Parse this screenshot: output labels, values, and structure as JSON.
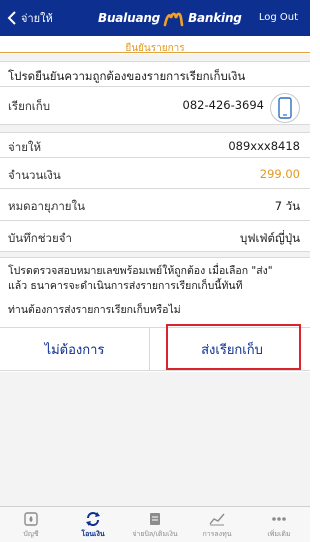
{
  "header": {
    "back_label": "จ่ายให้",
    "logo_word1": "Bualuang",
    "logo_word2": "Banking",
    "logout_label": "Log Out",
    "bar_color": "#0d2f8f"
  },
  "subtitle": "ยืนยันรายการ",
  "confirm_message": "โปรดยืนยันความถูกต้องของรายการเรียกเก็บเงิน",
  "details": {
    "request_from_label": "เรียกเก็บ",
    "request_from_value": "082-426-3694",
    "pay_to_label": "จ่ายให้",
    "pay_to_value": "089xxx8418",
    "amount_label": "จำนวนเงิน",
    "amount_value": "299.00",
    "expiry_label": "หมดอายุภายใน",
    "expiry_value": "7 วัน",
    "memo_label": "บันทึกช่วยจำ",
    "memo_value": "บุฟเฟ่ต์ญี่ปุ่น"
  },
  "notice": {
    "line1": "โปรดตรวจสอบหมายเลขพร้อมเพย์ให้ถูกต้อง เมื่อเลือก \"ส่ง\"",
    "line2": "แล้ว ธนาคารจะดำเนินการส่งรายการเรียกเก็บนี้ทันที",
    "question": "ท่านต้องการส่งรายการเรียกเก็บหรือไม่"
  },
  "buttons": {
    "cancel_label": "ไม่ต้องการ",
    "submit_label": "ส่งเรียกเก็บ"
  },
  "tabs": [
    {
      "label": "บัญชี",
      "icon": "account-icon"
    },
    {
      "label": "โอนเงิน",
      "icon": "transfer-icon"
    },
    {
      "label": "จ่ายบิล/เติมเงิน",
      "icon": "bill-icon"
    },
    {
      "label": "การลงทุน",
      "icon": "investment-icon"
    },
    {
      "label": "เพิ่มเติม",
      "icon": "more-icon"
    }
  ],
  "active_tab": "โอนเงิน",
  "colors": {
    "accent_orange": "#e3981f",
    "amount_orange": "#e3981f",
    "highlight_red": "#d9232d"
  }
}
